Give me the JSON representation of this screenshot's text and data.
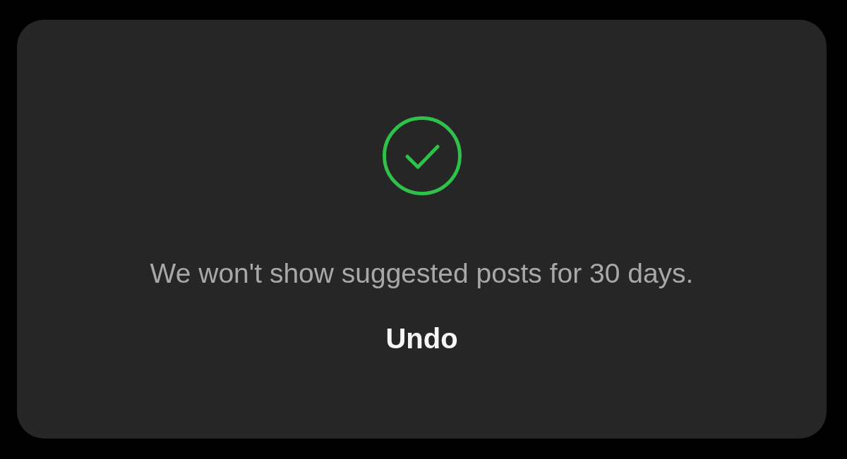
{
  "toast": {
    "message": "We won't show suggested posts for 30 days.",
    "action": "Undo"
  }
}
